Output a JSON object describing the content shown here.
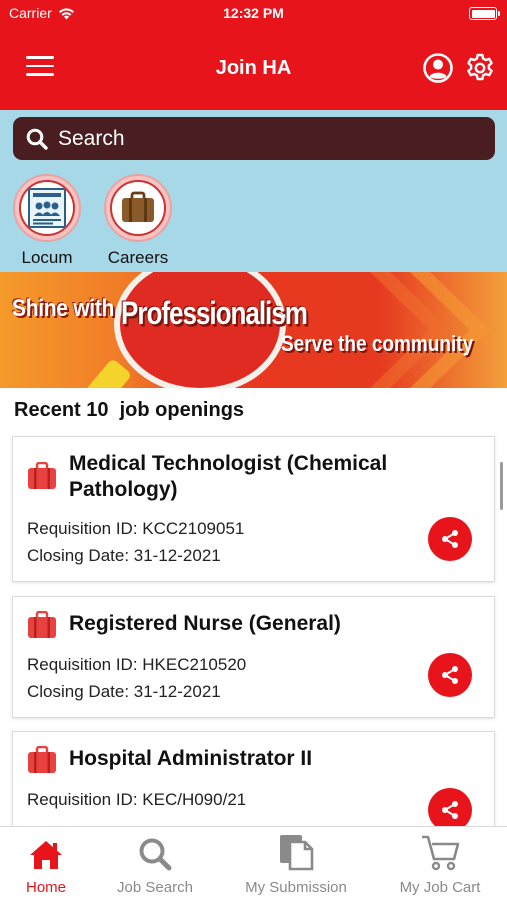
{
  "status_bar": {
    "carrier": "Carrier",
    "time": "12:32 PM"
  },
  "header": {
    "title": "Join HA"
  },
  "search": {
    "placeholder": "Search"
  },
  "quick_links": [
    {
      "label": "Locum",
      "icon": "locum-document-icon"
    },
    {
      "label": "Careers",
      "icon": "briefcase-icon"
    }
  ],
  "banner": {
    "left_text": "Shine with",
    "center_text": "Professionalism",
    "right_text": "Serve the community"
  },
  "section_title": "Recent 10  job openings",
  "jobs": [
    {
      "title": "Medical Technologist (Chemical Pathology)",
      "requisition": "Requisition ID: KCC2109051",
      "closing": "Closing Date: 31-12-2021"
    },
    {
      "title": "Registered Nurse (General)",
      "requisition": "Requisition ID: HKEC210520",
      "closing": "Closing Date: 31-12-2021"
    },
    {
      "title": "Hospital Administrator II",
      "requisition": "Requisition ID: KEC/H090/21",
      "closing": ""
    }
  ],
  "tabs": [
    {
      "label": "Home",
      "icon": "home-icon",
      "active": true
    },
    {
      "label": "Job Search",
      "icon": "search-icon",
      "active": false
    },
    {
      "label": "My Submission",
      "icon": "documents-icon",
      "active": false
    },
    {
      "label": "My Job Cart",
      "icon": "cart-icon",
      "active": false
    }
  ],
  "colors": {
    "brand_red": "#e8141c",
    "search_bg": "#4a1e20",
    "search_area_bg": "#a7d8e8"
  }
}
